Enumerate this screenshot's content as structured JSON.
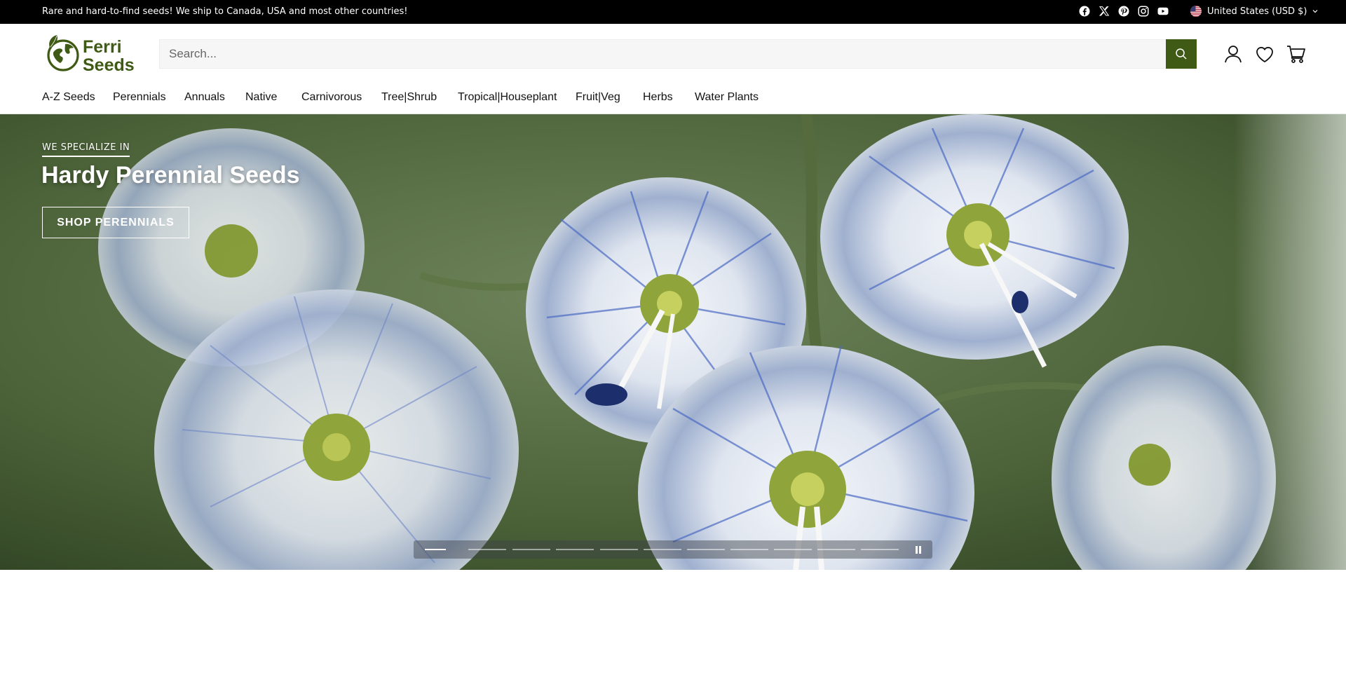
{
  "announcement": {
    "text": "Rare and hard-to-find seeds! We ship to Canada, USA and most other countries!"
  },
  "socials": [
    "facebook-icon",
    "x-icon",
    "pinterest-icon",
    "instagram-icon",
    "youtube-icon"
  ],
  "locale": {
    "label": "United States (USD $)",
    "icon": "us-flag-icon"
  },
  "logo": {
    "line1": "Ferri",
    "line2": "Seeds",
    "color": "#3f5a14"
  },
  "search": {
    "placeholder": "Search..."
  },
  "header_icons": [
    "account-icon",
    "wishlist-icon",
    "cart-icon"
  ],
  "nav": {
    "items": [
      {
        "label": "A-Z Seeds"
      },
      {
        "label": "Perennials"
      },
      {
        "label": "Annuals"
      },
      {
        "label": "Native"
      },
      {
        "label": "Carnivorous"
      },
      {
        "label": "Tree|Shrub"
      },
      {
        "label": "Tropical|Houseplant"
      },
      {
        "label": "Fruit|Veg"
      },
      {
        "label": "Herbs"
      },
      {
        "label": "Water Plants"
      }
    ]
  },
  "hero": {
    "eyebrow": "WE SPECIALIZE IN",
    "title": "Hardy Perennial Seeds",
    "cta": "SHOP PERENNIALS",
    "slide_count": 11,
    "active_slide": 1
  },
  "colors": {
    "brand_green": "#3f5a14",
    "announce_bg": "#000000"
  }
}
